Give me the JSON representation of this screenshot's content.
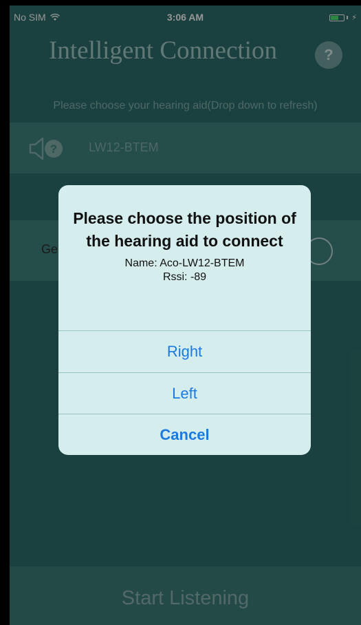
{
  "status_bar": {
    "carrier": "No SIM",
    "time": "3:06 AM",
    "charging_symbol": "⚡"
  },
  "header": {
    "title": "Intelligent Connection",
    "help_label": "?"
  },
  "instruction": "Please choose your hearing aid(Drop down to refresh)",
  "device_list": [
    {
      "name": "LW12-BTEM",
      "icon": "hearing-aid-unknown-icon"
    }
  ],
  "second_row": {
    "label_partial": "Ge"
  },
  "footer": {
    "start_label": "Start Listening"
  },
  "alert": {
    "title": "Please choose the position of the hearing aid to connect",
    "name_line": "Name: Aco-LW12-BTEM",
    "rssi_line": "Rssi: -89",
    "buttons": {
      "right": "Right",
      "left": "Left",
      "cancel": "Cancel"
    }
  },
  "colors": {
    "background": "#2b6a66",
    "row": "#3c7c78",
    "alert_bg": "#d6eded",
    "alert_button_text": "#1a7ae0"
  }
}
